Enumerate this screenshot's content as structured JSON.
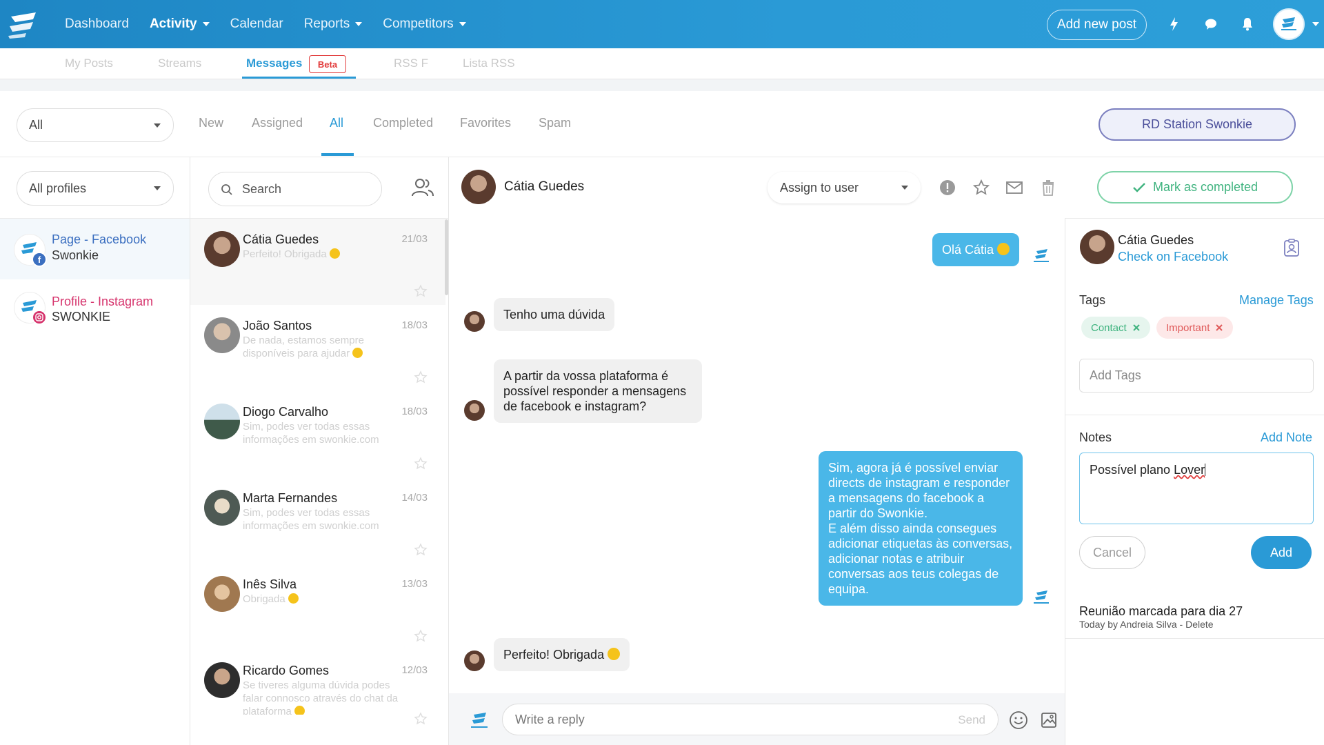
{
  "topnav": {
    "items": [
      {
        "label": "Dashboard",
        "active": false,
        "dropdown": false
      },
      {
        "label": "Activity",
        "active": true,
        "dropdown": true
      },
      {
        "label": "Calendar",
        "active": false,
        "dropdown": false
      },
      {
        "label": "Reports",
        "active": false,
        "dropdown": true
      },
      {
        "label": "Competitors",
        "active": false,
        "dropdown": true
      }
    ],
    "add_post": "Add new post",
    "icons": [
      "bolt-icon",
      "chat-bubble-icon",
      "bell-icon",
      "avatar"
    ]
  },
  "subtabs": {
    "items": [
      "My Posts",
      "Streams",
      "Messages",
      "RSS F",
      "Lista RSS"
    ],
    "active": "Messages",
    "beta": "Beta"
  },
  "filters": {
    "type_select": "All",
    "tabs": [
      "New",
      "Assigned",
      "All",
      "Completed",
      "Favorites",
      "Spam"
    ],
    "active_tab": "All",
    "account_button": "RD Station Swonkie"
  },
  "profiles": {
    "select": "All profiles",
    "items": [
      {
        "type": "Page - Facebook",
        "name": "Swonkie",
        "color": "#3b6fc0"
      },
      {
        "type": "Profile - Instagram",
        "name": "SWONKIE",
        "color": "#d6336c"
      }
    ]
  },
  "search": {
    "placeholder": "Search"
  },
  "conversations": [
    {
      "name": "Cátia Guedes",
      "date": "21/03",
      "preview": "Perfeito! Obrigada",
      "emoji": true
    },
    {
      "name": "João Santos",
      "date": "18/03",
      "preview": "De nada, estamos sempre disponíveis para ajudar",
      "emoji": true
    },
    {
      "name": "Diogo Carvalho",
      "date": "18/03",
      "preview": "Sim, podes ver todas essas informações em swonkie.com",
      "emoji": false
    },
    {
      "name": "Marta Fernandes",
      "date": "14/03",
      "preview": "Sim, podes ver todas essas informações em swonkie.com",
      "emoji": false
    },
    {
      "name": "Inês Silva",
      "date": "13/03",
      "preview": "Obrigada",
      "emoji": true
    },
    {
      "name": "Ricardo Gomes",
      "date": "12/03",
      "preview": "Se tiveres alguma dúvida podes falar connosco através do chat da plataforma",
      "emoji": true
    }
  ],
  "chat": {
    "contact": "Cátia Guedes",
    "assign_placeholder": "Assign to user",
    "mark_completed": "Mark as completed",
    "messages": [
      {
        "from": "me",
        "text": "Olá Cátia",
        "emoji": true
      },
      {
        "from": "contact",
        "text": "Tenho uma dúvida",
        "emoji": false
      },
      {
        "from": "contact",
        "text": "A partir da vossa plataforma é possível responder a mensagens de facebook e instagram?",
        "emoji": false
      },
      {
        "from": "me",
        "text": "Sim, agora já é possível enviar directs de instagram e responder a mensagens do facebook a partir do Swonkie.\nE além disso ainda consegues adicionar etiquetas às conversas, adicionar notas e atribuir conversas aos teus colegas de equipa.",
        "emoji": false
      },
      {
        "from": "contact",
        "text": "Perfeito! Obrigada",
        "emoji": true
      }
    ],
    "reply_placeholder": "Write a reply",
    "send_label": "Send"
  },
  "contact_panel": {
    "name": "Cátia Guedes",
    "link": "Check on Facebook",
    "tags_label": "Tags",
    "manage_tags": "Manage Tags",
    "tags": [
      {
        "label": "Contact",
        "color": "#3fb37f"
      },
      {
        "label": "Important",
        "color": "#e05a5a"
      }
    ],
    "add_tags_placeholder": "Add Tags",
    "notes_label": "Notes",
    "add_note": "Add Note",
    "note_draft": "Possível plano ",
    "note_draft_misspelled": "Lover",
    "cancel": "Cancel",
    "add": "Add",
    "saved_note": {
      "title": "Reunião marcada para dia 27",
      "meta": "Today by Andreia Silva - Delete"
    }
  },
  "colors": {
    "primary": "#2a9ad6",
    "success": "#3fb37f",
    "danger": "#e05a5a",
    "rd_station": "#4b4f9a"
  }
}
